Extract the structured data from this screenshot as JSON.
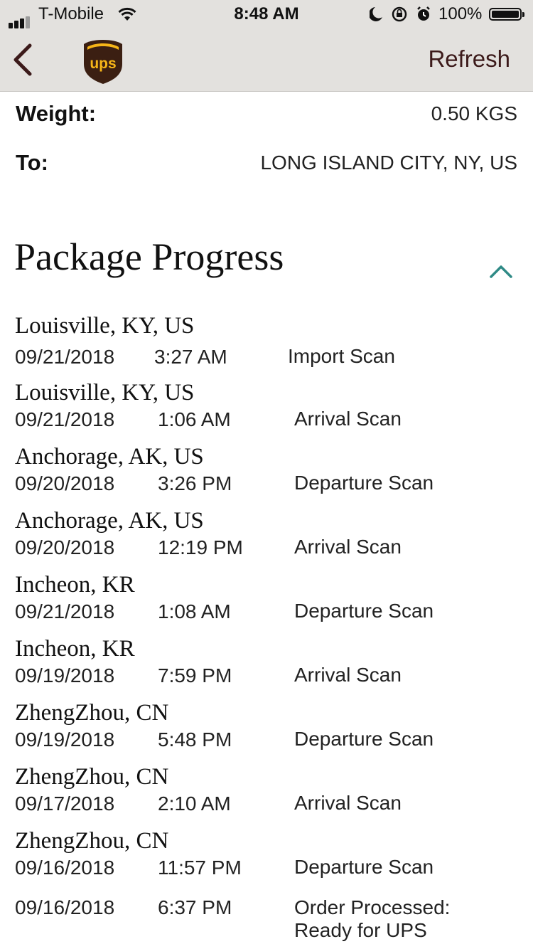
{
  "status_bar": {
    "carrier": "T-Mobile",
    "time": "8:48 AM",
    "battery": "100%"
  },
  "nav": {
    "logo_text": "ups",
    "refresh_label": "Refresh"
  },
  "shipment": {
    "weight_label": "Weight:",
    "weight_value": "0.50  KGS",
    "to_label": "To:",
    "to_value": "LONG ISLAND CITY, NY, US"
  },
  "progress": {
    "title": "Package Progress",
    "events": [
      {
        "location": "Louisville, KY, US",
        "date": "09/21/2018",
        "time": "3:27 AM",
        "description": "Import Scan"
      },
      {
        "location": "Louisville, KY, US",
        "date": "09/21/2018",
        "time": "1:06 AM",
        "description": "Arrival Scan"
      },
      {
        "location": "Anchorage, AK, US",
        "date": "09/20/2018",
        "time": "3:26 PM",
        "description": "Departure Scan"
      },
      {
        "location": "Anchorage, AK, US",
        "date": "09/20/2018",
        "time": "12:19 PM",
        "description": "Arrival Scan"
      },
      {
        "location": "Incheon, KR",
        "date": "09/21/2018",
        "time": "1:08 AM",
        "description": "Departure Scan"
      },
      {
        "location": "Incheon, KR",
        "date": "09/19/2018",
        "time": "7:59 PM",
        "description": "Arrival Scan"
      },
      {
        "location": "ZhengZhou, CN",
        "date": "09/19/2018",
        "time": "5:48 PM",
        "description": "Departure Scan"
      },
      {
        "location": "ZhengZhou, CN",
        "date": "09/17/2018",
        "time": "2:10 AM",
        "description": "Arrival Scan"
      },
      {
        "location": "ZhengZhou, CN",
        "date": "09/16/2018",
        "time": "11:57 PM",
        "description": "Departure Scan"
      },
      {
        "location": "",
        "date": "09/16/2018",
        "time": "6:37 PM",
        "description": "Order Processed:",
        "description_line2": "Ready for UPS"
      }
    ]
  },
  "colors": {
    "nav_bg": "#e3e1de",
    "refresh_text": "#3c1a1a",
    "ups_brown": "#3b1f12",
    "ups_gold": "#f6b518",
    "chevron_teal": "#2f8a86"
  }
}
